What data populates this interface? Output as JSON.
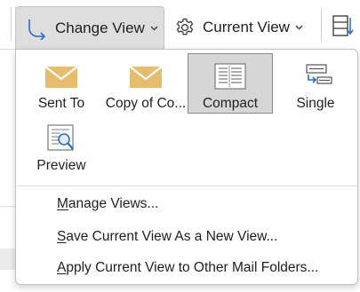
{
  "ribbon": {
    "change_view_label": "Change View",
    "current_view_label": "Current View"
  },
  "gallery": {
    "items": [
      {
        "label": "Sent To",
        "icon": "envelope-icon",
        "selected": false
      },
      {
        "label": "Copy of Co...",
        "icon": "envelope-icon",
        "selected": false
      },
      {
        "label": "Compact",
        "icon": "compact-view-icon",
        "selected": true
      },
      {
        "label": "Single",
        "icon": "single-view-icon",
        "selected": false
      },
      {
        "label": "Preview",
        "icon": "preview-view-icon",
        "selected": false
      }
    ]
  },
  "menu": {
    "manage_views": {
      "accel": "M",
      "rest": "anage Views..."
    },
    "save_view": {
      "accel": "S",
      "rest": "ave Current View As a New View..."
    },
    "apply_view": {
      "accel": "A",
      "rest": "pply Current View to Other Mail Folders..."
    }
  },
  "colors": {
    "envelope": "#e8bc6e",
    "selected_bg": "#d6d6d6",
    "accent_blue": "#2b6bc6"
  }
}
